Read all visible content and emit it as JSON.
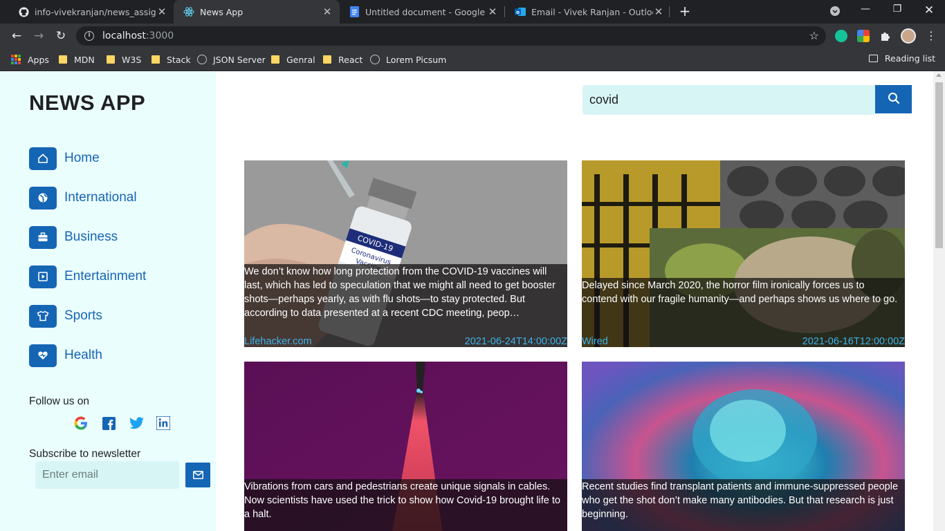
{
  "browser": {
    "tabs": [
      {
        "title": "info-vivekranjan/news_assignment",
        "icon": "github-icon"
      },
      {
        "title": "News App",
        "icon": "react-icon",
        "active": true
      },
      {
        "title": "Untitled document - Google Docs",
        "icon": "google-docs-icon"
      },
      {
        "title": "Email - Vivek Ranjan - Outlook",
        "icon": "outlook-icon"
      }
    ],
    "url_host": "localhost",
    "url_port": ":3000",
    "bookmarks": [
      {
        "label": "Apps",
        "icon": "apps-grid-icon"
      },
      {
        "label": "MDN",
        "icon": "folder-icon"
      },
      {
        "label": "W3S",
        "icon": "folder-icon"
      },
      {
        "label": "Stack",
        "icon": "folder-icon"
      },
      {
        "label": "JSON Server",
        "icon": "globe-icon"
      },
      {
        "label": "Genral",
        "icon": "folder-icon"
      },
      {
        "label": "React",
        "icon": "folder-icon"
      },
      {
        "label": "Lorem Picsum",
        "icon": "globe-icon"
      }
    ],
    "reading_list": "Reading list"
  },
  "sidebar": {
    "logo": "NEWS APP",
    "nav": [
      {
        "label": "Home",
        "icon": "home-icon"
      },
      {
        "label": "International",
        "icon": "globe-icon"
      },
      {
        "label": "Business",
        "icon": "briefcase-icon"
      },
      {
        "label": "Entertainment",
        "icon": "play-icon"
      },
      {
        "label": "Sports",
        "icon": "tshirt-icon"
      },
      {
        "label": "Health",
        "icon": "heart-icon"
      }
    ],
    "follow_label": "Follow us on",
    "social": [
      "google-icon",
      "facebook-icon",
      "twitter-icon",
      "linkedin-icon"
    ],
    "newsletter_label": "Subscribe to newsletter",
    "email_placeholder": "Enter email"
  },
  "search": {
    "value": "covid"
  },
  "articles": [
    {
      "description": "We don’t know how long protection from the COVID-19 vaccines will last, which has led to speculation that we might all need to get booster shots—perhaps yearly, as with flu shots—to stay protected. But according to data presented at a recent CDC meeting, peop…",
      "source": "Lifehacker.com",
      "date": "2021-06-24T14:00:00Z"
    },
    {
      "description": "Delayed since March 2020, the horror film ironically forces us to contend with our fragile humanity—and perhaps shows us where to go.",
      "source": "Wired",
      "date": "2021-06-16T12:00:00Z"
    },
    {
      "description": "Vibrations from cars and pedestrians create unique signals in cables. Now scientists have used the trick to show how Covid-19 brought life to a halt.",
      "source": "",
      "date": ""
    },
    {
      "description": "Recent studies find transplant patients and immune-suppressed people who get the shot don’t make many antibodies. But that research is just beginning.",
      "source": "",
      "date": ""
    }
  ],
  "colors": {
    "accent": "#1565b5",
    "sidebar_bg": "#ebfefe",
    "input_bg": "#d8f5f5",
    "meta_text": "#3eb3ea"
  }
}
